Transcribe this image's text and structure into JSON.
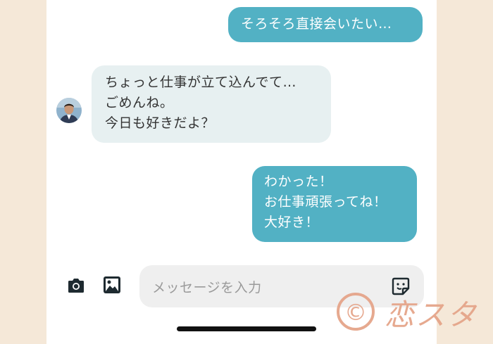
{
  "messages": [
    {
      "id": "m1",
      "direction": "outgoing",
      "text": "そろそろ直接会いたい…"
    },
    {
      "id": "m2",
      "direction": "incoming",
      "text": "ちょっと仕事が立て込んでて…\nごめんね。\n今日も好きだよ？"
    },
    {
      "id": "m3",
      "direction": "outgoing",
      "text": "わかった！\nお仕事頑張ってね！\n大好き！"
    }
  ],
  "composer": {
    "placeholder": "メッセージを入力",
    "icons": [
      "camera-icon",
      "image-icon",
      "sticker-icon"
    ]
  },
  "watermark": {
    "symbol": "©",
    "text": "恋スタ"
  },
  "colors": {
    "outgoing_bubble": "#52b1c4",
    "incoming_bubble": "#e7f0f1",
    "page_background": "#f5e8d8",
    "watermark": "#e5a58a"
  }
}
